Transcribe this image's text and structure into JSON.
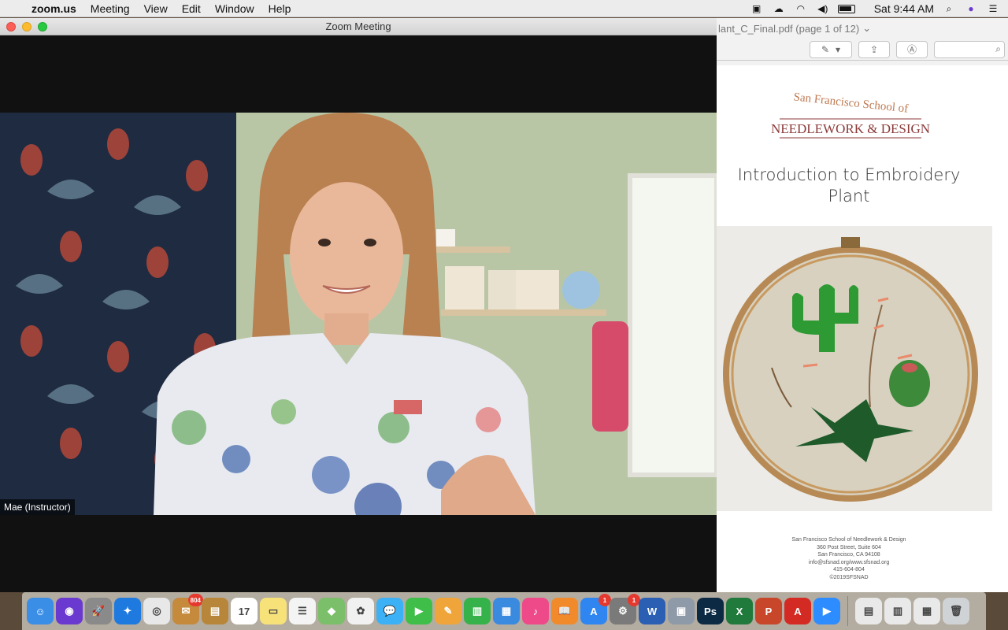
{
  "menubar": {
    "app_name": "zoom.us",
    "menus": [
      "Meeting",
      "View",
      "Edit",
      "Window",
      "Help"
    ],
    "clock": "Sat 9:44 AM",
    "status_icons": [
      "zoom-camera-icon",
      "creative-cloud-icon",
      "wifi-icon",
      "volume-icon",
      "battery-icon",
      "search-icon",
      "siri-icon",
      "notification-center-icon"
    ]
  },
  "zoom": {
    "window_title": "Zoom Meeting",
    "participant_name": "Mae (Instructor)"
  },
  "preview": {
    "window_title": "lant_C_Final.pdf (page 1 of 12)",
    "title_chevron": "⌄",
    "toolbar": [
      "markup-pen-icon",
      "chevron-down-icon",
      "share-icon",
      "annotate-icon",
      "search-field"
    ],
    "document": {
      "logo_line1": "San Francisco School of",
      "logo_line2": "NEEDLEWORK & DESIGN",
      "title_line1": "Introduction to Embroidery",
      "title_line2": "Plant",
      "address_lines": [
        "San Francisco School of Needlework & Design",
        "360 Post Street, Suite 604",
        "San Francisco, CA 94108",
        "info@sfsnad.org/www.sfsnad.org",
        "415-604-804",
        "©2019SFSNAD"
      ]
    }
  },
  "dock": {
    "items": [
      {
        "name": "finder",
        "color": "#3a8ee6",
        "glyph": "☺"
      },
      {
        "name": "siri",
        "color": "#6a3ad0",
        "glyph": "◉"
      },
      {
        "name": "launchpad",
        "color": "#8a8a8a",
        "glyph": "🚀"
      },
      {
        "name": "safari",
        "color": "#1f7ae0",
        "glyph": "✦"
      },
      {
        "name": "chrome",
        "color": "#e8e8e8",
        "glyph": "◎"
      },
      {
        "name": "mail-stamp",
        "color": "#c58a3c",
        "glyph": "✉",
        "badge": "804"
      },
      {
        "name": "notefile",
        "color": "#b8863a",
        "glyph": "▤"
      },
      {
        "name": "calendar",
        "color": "#ffffff",
        "glyph": "17"
      },
      {
        "name": "notes",
        "color": "#f7e27a",
        "glyph": "▭"
      },
      {
        "name": "reminders",
        "color": "#f4f4f4",
        "glyph": "☰"
      },
      {
        "name": "maps",
        "color": "#7bbf6a",
        "glyph": "◆"
      },
      {
        "name": "photos",
        "color": "#f1f1f1",
        "glyph": "✿"
      },
      {
        "name": "messages",
        "color": "#3db1f5",
        "glyph": "💬"
      },
      {
        "name": "facetime",
        "color": "#3fbf4a",
        "glyph": "▶"
      },
      {
        "name": "pages",
        "color": "#f0a53a",
        "glyph": "✎"
      },
      {
        "name": "numbers",
        "color": "#35b24a",
        "glyph": "▥"
      },
      {
        "name": "keynote",
        "color": "#3a8ae0",
        "glyph": "▦"
      },
      {
        "name": "itunes",
        "color": "#ee4a8a",
        "glyph": "♪"
      },
      {
        "name": "books",
        "color": "#f08a2a",
        "glyph": "📖"
      },
      {
        "name": "app-store",
        "color": "#2f86f0",
        "glyph": "A",
        "badge": "1"
      },
      {
        "name": "system-preferences",
        "color": "#7a7a7a",
        "glyph": "⚙",
        "badge": "1"
      },
      {
        "name": "word",
        "color": "#2b5fb4",
        "glyph": "W"
      },
      {
        "name": "preview",
        "color": "#8f9aa8",
        "glyph": "▣"
      },
      {
        "name": "photoshop",
        "color": "#0c2a44",
        "glyph": "Ps"
      },
      {
        "name": "excel",
        "color": "#1f7a3c",
        "glyph": "X"
      },
      {
        "name": "powerpoint",
        "color": "#c8472a",
        "glyph": "P"
      },
      {
        "name": "acrobat",
        "color": "#d42a24",
        "glyph": "A"
      },
      {
        "name": "zoom",
        "color": "#2d8cff",
        "glyph": "▶"
      },
      {
        "name": "pdf-document",
        "color": "#e9e9e9",
        "glyph": "▤"
      },
      {
        "name": "spreadsheet-document",
        "color": "#e9e9e9",
        "glyph": "▥"
      },
      {
        "name": "downloads-stack",
        "color": "#e9e9e9",
        "glyph": "▦"
      },
      {
        "name": "trash",
        "color": "#cfd3d6",
        "glyph": "🗑"
      }
    ]
  }
}
